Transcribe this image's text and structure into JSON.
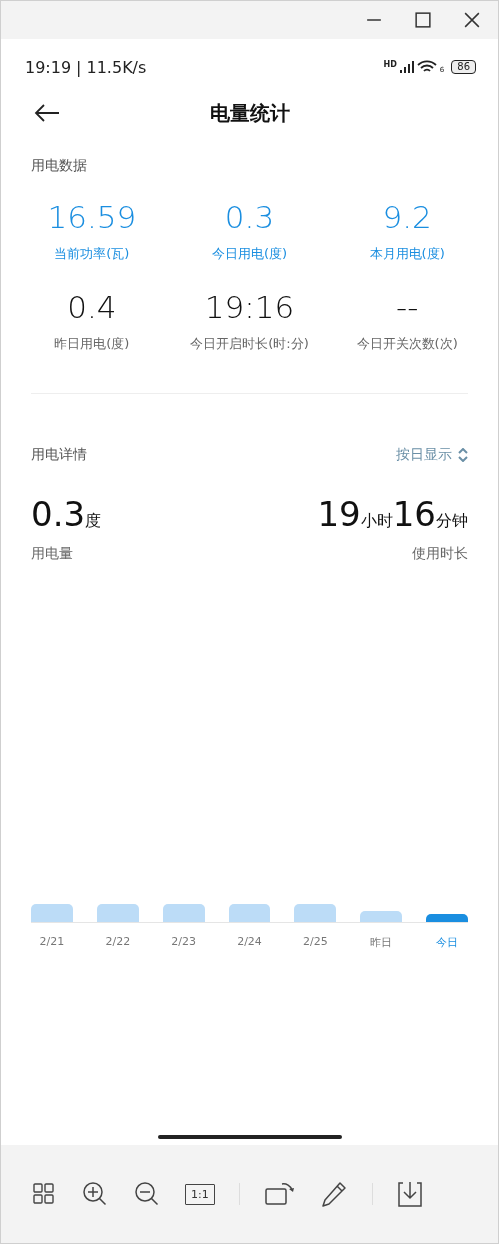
{
  "status_bar": {
    "time": "19:19",
    "separator": "|",
    "speed": "11.5K/s",
    "signal_badge": "HD",
    "wifi_badge": "6",
    "battery": "86"
  },
  "header": {
    "title": "电量统计"
  },
  "usage_data": {
    "title": "用电数据",
    "stats": [
      {
        "value": "16.59",
        "label": "当前功率(瓦)",
        "highlight": true
      },
      {
        "value": "0.3",
        "label": "今日用电(度)",
        "highlight": true
      },
      {
        "value": "9.2",
        "label": "本月用电(度)",
        "highlight": true
      },
      {
        "value": "0.4",
        "label": "昨日用电(度)",
        "highlight": false
      },
      {
        "value": "19:16",
        "label": "今日开启时长(时:分)",
        "highlight": false
      },
      {
        "value": "--",
        "label": "今日开关次数(次)",
        "highlight": false
      }
    ]
  },
  "usage_detail": {
    "title": "用电详情",
    "mode": "按日显示",
    "energy": {
      "value": "0.3",
      "unit": "度",
      "label": "用电量"
    },
    "duration": {
      "hours": "19",
      "hours_unit": "小时",
      "minutes": "16",
      "minutes_unit": "分钟",
      "label": "使用时长"
    },
    "bars": [
      {
        "label": "2/21",
        "selected": false
      },
      {
        "label": "2/22",
        "selected": false
      },
      {
        "label": "2/23",
        "selected": false
      },
      {
        "label": "2/24",
        "selected": false
      },
      {
        "label": "2/25",
        "selected": false
      },
      {
        "label": "昨日",
        "selected": false
      },
      {
        "label": "今日",
        "selected": true
      }
    ]
  },
  "toolbar": {
    "actual_size_label": "1:1"
  }
}
